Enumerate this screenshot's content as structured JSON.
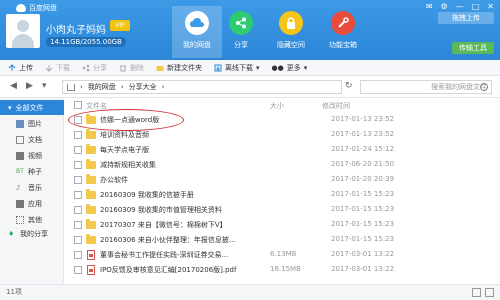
{
  "header": {
    "app_title": "百度网盘",
    "username": "小肉丸子妈妈",
    "vip_badge": "VIP",
    "quota": "14.11GB/2055.00GB",
    "login_btn": "拖拽上传",
    "side_btn": "传输工具",
    "nav": [
      {
        "label": "我的网盘",
        "color": "#3a9be8"
      },
      {
        "label": "分享",
        "color": "#27ae60"
      },
      {
        "label": "隐藏空间",
        "color": "#f1c40f"
      },
      {
        "label": "功能宝箱",
        "color": "#e74c3c"
      }
    ]
  },
  "toolbar": {
    "upload": "上传",
    "download": "下载",
    "share": "分享",
    "delete": "删除",
    "new_folder": "新建文件夹",
    "offline": "离线下载",
    "more": "更多"
  },
  "address": {
    "crumb1": "我的网盘",
    "crumb2": "分享大全",
    "search_placeholder": "搜索我的网盘文件"
  },
  "sidebar": {
    "items": [
      {
        "label": "全部文件"
      },
      {
        "label": "图片"
      },
      {
        "label": "文档"
      },
      {
        "label": "视频"
      },
      {
        "label": "种子"
      },
      {
        "label": "音乐"
      },
      {
        "label": "应用"
      },
      {
        "label": "其他"
      },
      {
        "label": "我的分享"
      }
    ]
  },
  "list": {
    "headers": {
      "name": "文件名",
      "size": "大小",
      "date": "修改时间"
    },
    "rows": [
      {
        "name": "信娜一点通word版",
        "size": "",
        "date": "2017-01-13 23:52",
        "type": "folder"
      },
      {
        "name": "培训资料及音频",
        "size": "",
        "date": "2017-01-13 23:52",
        "type": "folder"
      },
      {
        "name": "每天学点电子版",
        "size": "",
        "date": "2017-01-24 15:12",
        "type": "folder"
      },
      {
        "name": "减持新规相关收集",
        "size": "",
        "date": "2017-06-20 21:50",
        "type": "folder"
      },
      {
        "name": "办公软件",
        "size": "",
        "date": "2017-01-20 20:39",
        "type": "folder"
      },
      {
        "name": "20160309 我收集的信披手册",
        "size": "",
        "date": "2017-01-15 15:23",
        "type": "folder"
      },
      {
        "name": "20160309 我收集的市值管理相关资料",
        "size": "",
        "date": "2017-01-15 15:23",
        "type": "folder"
      },
      {
        "name": "20170307 来自【微信号：棉棉树下V】",
        "size": "",
        "date": "2017-01-15 15:23",
        "type": "folder"
      },
      {
        "name": "20160306 来自小伙伴整理：年报信息披...",
        "size": "",
        "date": "2017-01-15 15:23",
        "type": "folder"
      },
      {
        "name": "董事会秘书工作提任实践-深圳证券交易...",
        "size": "6.13MB",
        "date": "2017-03-01 13:22",
        "type": "pdf"
      },
      {
        "name": "IPO反馈及审核意见汇编[20170206版].pdf",
        "size": "16.15MB",
        "date": "2017-03-01 13:22",
        "type": "pdf"
      }
    ]
  },
  "status": {
    "count": "11项"
  }
}
